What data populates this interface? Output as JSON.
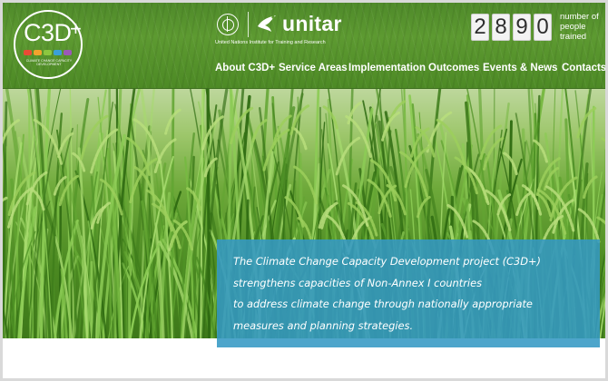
{
  "logo": {
    "text": "C3D",
    "plus": "+",
    "subtitle": "CLIMATE CHANGE CAPACITY DEVELOPMENT",
    "bar_colors": [
      "#e94b35",
      "#f2a32d",
      "#8cc63f",
      "#3aa0d8",
      "#9b59b6"
    ]
  },
  "partner": {
    "name": "unitar",
    "subtitle": "United Nations Institute for Training and Research"
  },
  "counter": {
    "digits": [
      "2",
      "8",
      "9",
      "0"
    ],
    "label": "number of people trained"
  },
  "nav": {
    "items": [
      {
        "label": "About C3D+"
      },
      {
        "label": "Service Areas"
      },
      {
        "label": "Implementation"
      },
      {
        "label": "Outcomes"
      },
      {
        "label": "Events & News"
      },
      {
        "label": "Contacts"
      }
    ]
  },
  "hero": {
    "caption_lines": [
      "The Climate Change Capacity Development project (C3D+)",
      "strengthens capacities of Non-Annex I countries",
      "to address climate change through nationally appropriate",
      "measures and planning strategies."
    ]
  },
  "colors": {
    "header_green": "#5d9a31",
    "caption_blue": "#3498c4",
    "frame_gray": "#d9d9d9"
  }
}
